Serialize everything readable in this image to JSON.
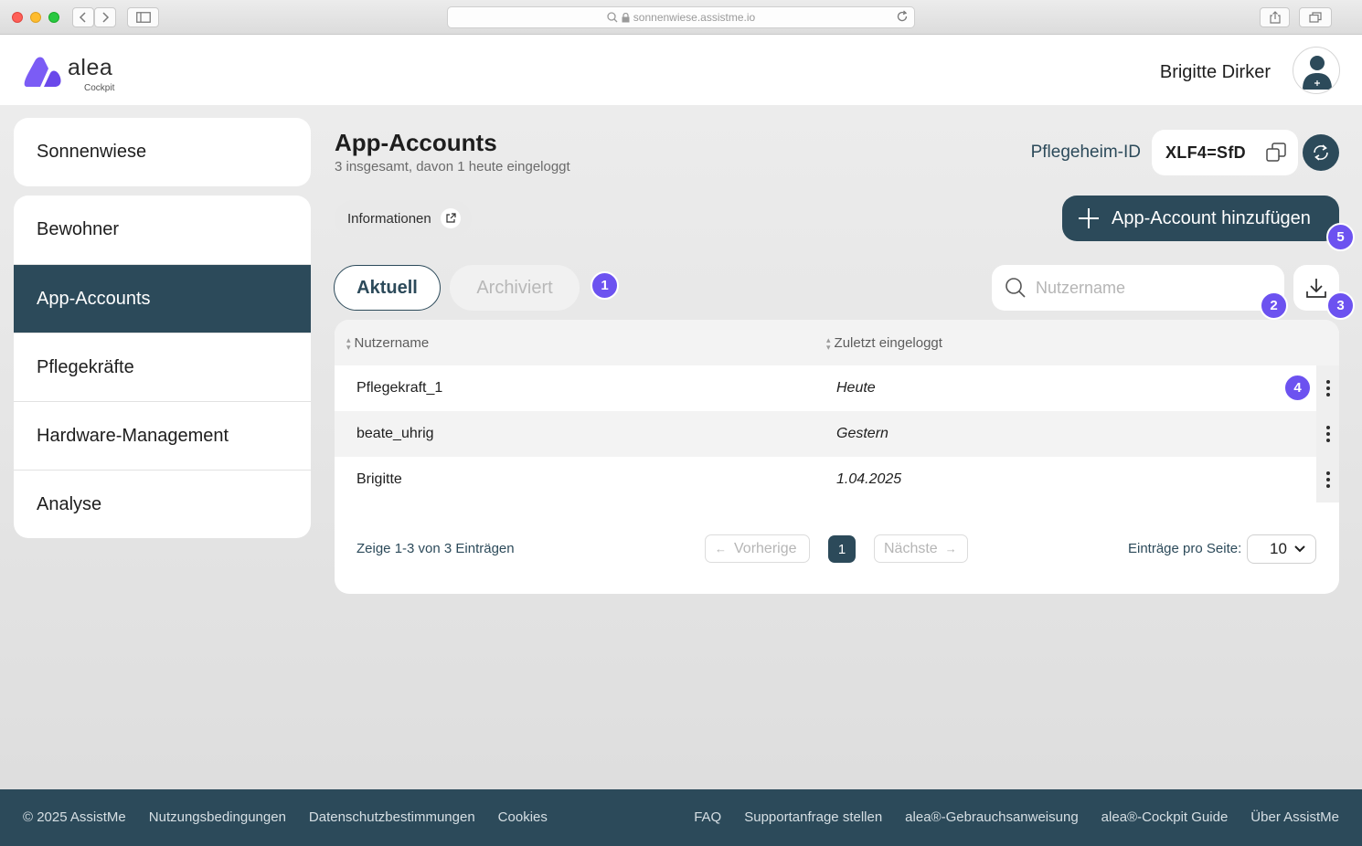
{
  "browser": {
    "url": "sonnenwiese.assistme.io"
  },
  "header": {
    "logo_text": "alea",
    "logo_sub": "Cockpit",
    "user_name": "Brigitte Dirker"
  },
  "sidebar": {
    "facility": "Sonnenwiese",
    "items": [
      {
        "label": "Bewohner",
        "active": false
      },
      {
        "label": "App-Accounts",
        "active": true
      },
      {
        "label": "Pflegekräfte",
        "active": false
      },
      {
        "label": "Hardware-Management",
        "active": false
      },
      {
        "label": "Analyse",
        "active": false
      }
    ]
  },
  "page": {
    "title": "App-Accounts",
    "subtitle": "3 insgesamt, davon 1 heute eingeloggt",
    "pid_label": "Pflegeheim-ID",
    "pid_value": "XLF4=SfD",
    "info_button": "Informationen",
    "add_button": "App-Account hinzufügen"
  },
  "tabs": {
    "current": "Aktuell",
    "archived": "Archiviert"
  },
  "search": {
    "placeholder": "Nutzername"
  },
  "badges": [
    "1",
    "2",
    "3",
    "4",
    "5"
  ],
  "table": {
    "columns": [
      "Nutzername",
      "Zuletzt eingeloggt"
    ],
    "rows": [
      {
        "user": "Pflegekraft_1",
        "last_login": "Heute"
      },
      {
        "user": "beate_uhrig",
        "last_login": "Gestern"
      },
      {
        "user": "Brigitte",
        "last_login": "1.04.2025"
      }
    ]
  },
  "pagination": {
    "info": "Zeige 1-3 von 3 Einträgen",
    "prev": "Vorherige",
    "next": "Nächste",
    "current_page": "1",
    "per_page_label": "Einträge pro Seite:",
    "per_page_value": "10"
  },
  "footer": {
    "left": [
      "© 2025 AssistMe",
      "Nutzungsbedingungen",
      "Datenschutzbestimmungen",
      "Cookies"
    ],
    "right": [
      "FAQ",
      "Supportanfrage stellen",
      "alea®-Gebrauchsanweisung",
      "alea®-Cockpit Guide",
      "Über AssistMe"
    ]
  },
  "colors": {
    "primary": "#2c4a5a",
    "badge": "#6c52f0",
    "logo": "#7b5cf5"
  }
}
